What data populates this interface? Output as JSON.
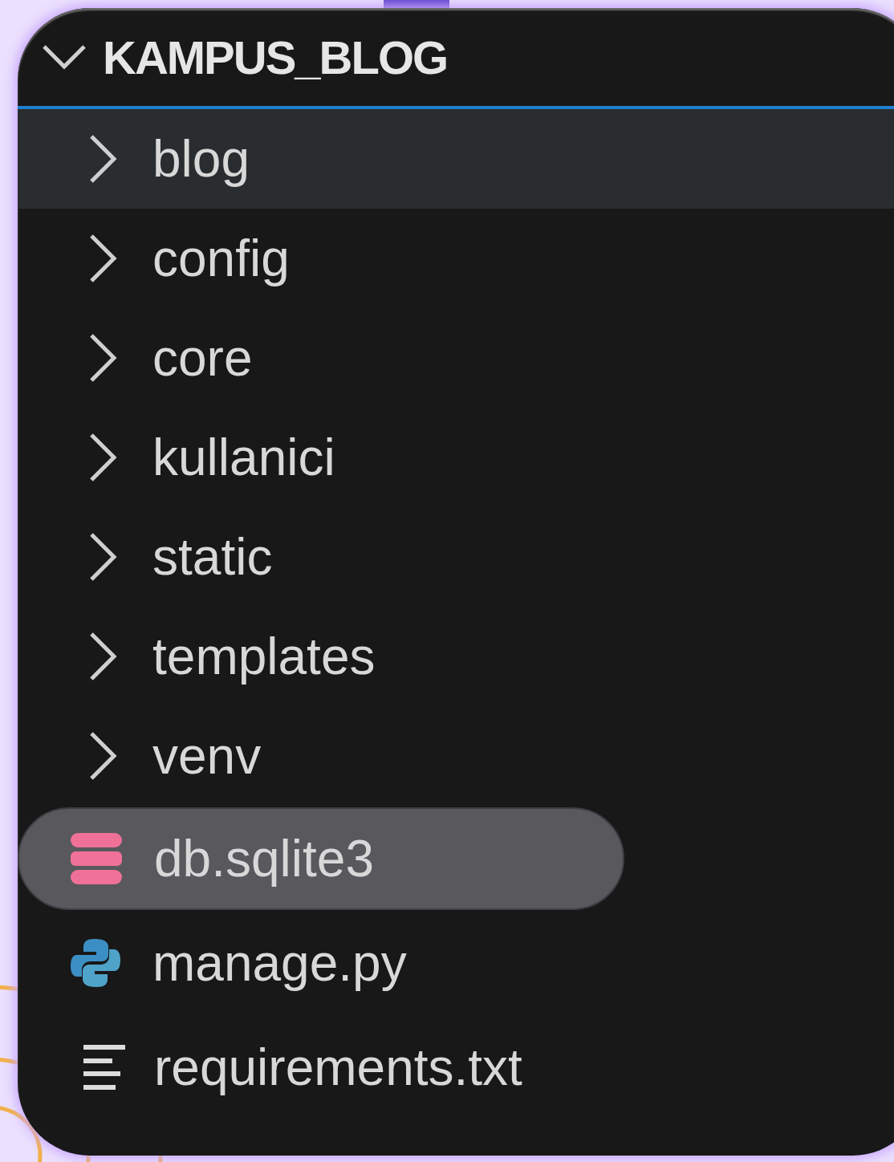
{
  "explorer": {
    "root": {
      "label": "KAMPUS_BLOG",
      "expanded": true
    },
    "items": [
      {
        "kind": "folder",
        "label": "blog",
        "expanded": false,
        "selected": true
      },
      {
        "kind": "folder",
        "label": "config",
        "expanded": false,
        "selected": false
      },
      {
        "kind": "folder",
        "label": "core",
        "expanded": false,
        "selected": false
      },
      {
        "kind": "folder",
        "label": "kullanici",
        "expanded": false,
        "selected": false
      },
      {
        "kind": "folder",
        "label": "static",
        "expanded": false,
        "selected": false
      },
      {
        "kind": "folder",
        "label": "templates",
        "expanded": false,
        "selected": false
      },
      {
        "kind": "folder",
        "label": "venv",
        "expanded": false,
        "selected": false
      },
      {
        "kind": "database",
        "label": "db.sqlite3",
        "hovered": true
      },
      {
        "kind": "python",
        "label": "manage.py",
        "hovered": false
      },
      {
        "kind": "text",
        "label": "requirements.txt",
        "hovered": false
      }
    ]
  }
}
